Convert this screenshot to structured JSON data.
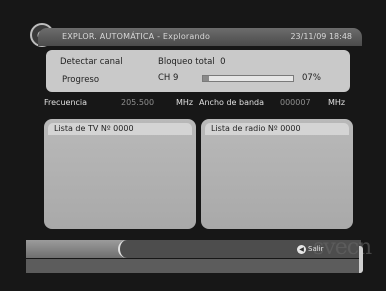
{
  "header": {
    "title": "EXPLOR. AUTOMÁTICA - Explorando",
    "datetime": "23/11/09  18:48"
  },
  "status": {
    "detect_label": "Detectar canal",
    "lock_label": "Bloqueo total",
    "lock_value": "0",
    "progress_label": "Progreso",
    "channel": "CH 9",
    "percent_text": "07%",
    "progress_fraction": 0.07
  },
  "signal": {
    "frequency_label": "Frecuencia",
    "frequency_value": "205.500",
    "frequency_unit": "MHz",
    "bandwidth_label": "Ancho de banda",
    "bandwidth_value": "000007",
    "bandwidth_unit": "MHz"
  },
  "lists": {
    "tv_header": "Lista de TV  Nº   0000",
    "radio_header": "Lista de radio  Nº   0000"
  },
  "footer": {
    "exit_label": "Salir",
    "brand": "svecn"
  },
  "icons": {
    "logo": "satellite-dish-icon",
    "exit": "exit-button-icon"
  }
}
